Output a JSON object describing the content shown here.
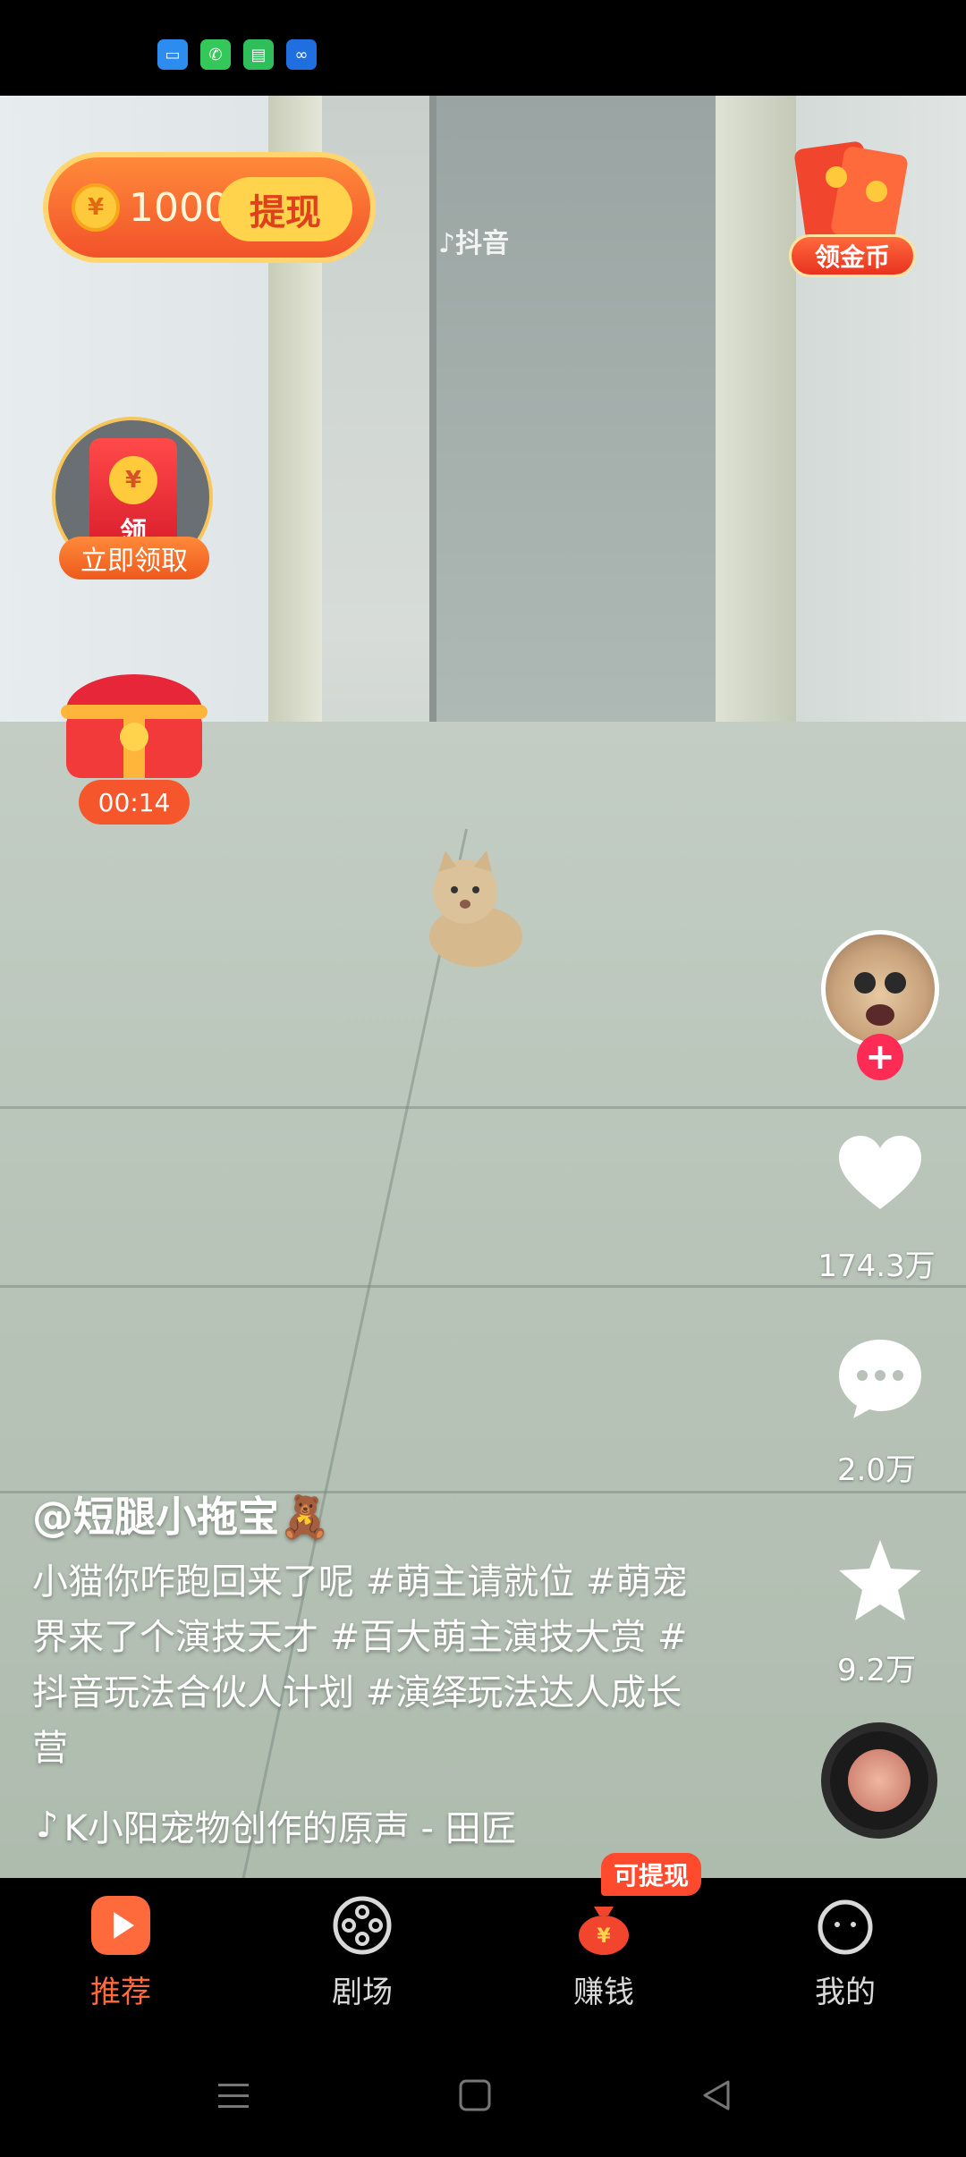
{
  "status_bar": {
    "icons": [
      "files-icon",
      "phone-icon",
      "messages-icon",
      "app-icon"
    ]
  },
  "video": {
    "watermark": "抖音",
    "author": "@短腿小拖宝🧸",
    "caption": "小猫你咋跑回来了呢 #萌主请就位 #萌宠界来了个演技天才 #百大萌主演技大赏 #抖音玩法合伙人计划 #演绎玩法达人成长营",
    "music": "K小阳宠物创作的原声 - 田匠"
  },
  "coins": {
    "amount": "1000",
    "withdraw_label": "提现",
    "coin_symbol": "¥"
  },
  "promo": {
    "collect_coins_label": "领金币",
    "claim_envelope_text": "领",
    "claim_label": "立即领取",
    "chest_timer": "00:14"
  },
  "actions": {
    "likes": "174.3万",
    "comments": "2.0万",
    "favorites": "9.2万",
    "follow_symbol": "+"
  },
  "tabs": [
    {
      "label": "推荐",
      "icon": "play-icon",
      "active": true
    },
    {
      "label": "剧场",
      "icon": "film-reel-icon",
      "active": false
    },
    {
      "label": "赚钱",
      "icon": "money-bag-icon",
      "active": false
    },
    {
      "label": "我的",
      "icon": "profile-face-icon",
      "active": false
    }
  ],
  "earn_badge": "可提现",
  "colors": {
    "accent": "#ff6a3d",
    "follow": "#fe2c55",
    "coin_gold": "#ffd44c"
  }
}
